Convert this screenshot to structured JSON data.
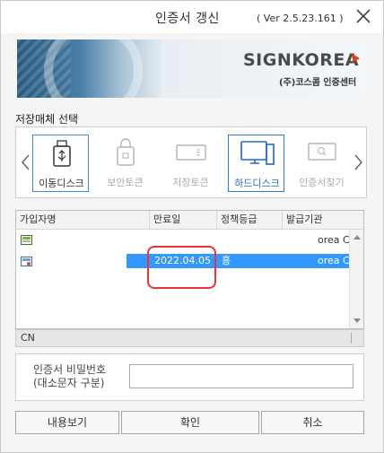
{
  "window": {
    "title": "인증서 갱신",
    "version": "( Ver 2.5.23.161 )"
  },
  "banner": {
    "brand": "SIGNKOREA",
    "sub": "(주)코스콤 인증센터",
    "arrow_color": "#e0401b"
  },
  "media": {
    "section_label": "저장매체 선택",
    "items": [
      {
        "label": "이동디스크",
        "icon": "usb-drive-icon",
        "enabled": true,
        "selected": false
      },
      {
        "label": "보안토큰",
        "icon": "security-token-icon",
        "enabled": false,
        "selected": false
      },
      {
        "label": "저장토큰",
        "icon": "storage-token-icon",
        "enabled": false,
        "selected": false
      },
      {
        "label": "하드디스크",
        "icon": "monitor-icon",
        "enabled": true,
        "selected": true
      },
      {
        "label": "인증서찾기",
        "icon": "find-certificate-icon",
        "enabled": false,
        "selected": false
      }
    ]
  },
  "table": {
    "columns": [
      "가입자명",
      "만료일",
      "정책등급",
      "발급기관"
    ],
    "rows": [
      {
        "name": "",
        "expiry": "",
        "policy": "",
        "issuer": "orea C",
        "selected": false
      },
      {
        "name": "",
        "expiry": "2022.04.05",
        "policy": "흥",
        "issuer": "orea C",
        "selected": true
      }
    ],
    "status_text": "CN"
  },
  "password": {
    "label_line1": "인증서 비밀번호",
    "label_line2": "(대소문자 구분)",
    "value": ""
  },
  "buttons": {
    "view": "내용보기",
    "ok": "확인",
    "cancel": "취소"
  },
  "colors": {
    "selection": "#3399ff",
    "highlight_ring": "#e8333a",
    "selected_media_border": "#2e7bd8"
  }
}
